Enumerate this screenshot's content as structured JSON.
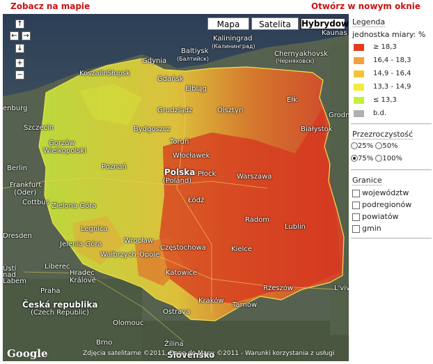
{
  "top": {
    "left_link": "Zobacz na mapie",
    "right_link": "Otwórz w nowym oknie"
  },
  "map": {
    "type_buttons": [
      "Mapa",
      "Satelita",
      "Hybrydowa"
    ],
    "selected_type": "Hybrydowa",
    "nav": {
      "up": "↑",
      "left": "←",
      "right": "→",
      "down": "↓",
      "zoom_in": "+",
      "zoom_out": "−"
    },
    "cities": {
      "kaliningrad": "Kaliningrad",
      "kaliningrad_ru": "(Калининград)",
      "kaunas": "Kaunas",
      "baltiysk": "Baltiysk",
      "baltiysk_ru": "(Балтийск)",
      "chernyakhovsk": "Chernyakhovsk",
      "chernyakhovsk_ru": "(Черняховск)",
      "gdynia": "Gdynia",
      "koszalin": "Koszalin",
      "slupsk": "Słupsk",
      "gdansk": "Gdańsk",
      "elblag": "Elbląg",
      "grudziadz": "Grudziądz",
      "olsztyn": "Olsztyn",
      "elk": "Ełk",
      "grodno": "Grodno",
      "szczecin": "Szczecin",
      "bydgoszcz": "Bydgoszcz",
      "torun": "Toruń",
      "bialystok": "Białystok",
      "gorzow": "Gorzów",
      "wielkopolski": "Wielkopolski",
      "wloclawek": "Włocławek",
      "berlin": "Berlin",
      "poznan": "Poznań",
      "polska": "Polska",
      "polska_sub": "(Poland)",
      "plock": "Płock",
      "warszawa": "Warszawa",
      "frankfurt": "Frankfurt",
      "frankfurt_sub": "(Oder)",
      "cottbus": "Cottbus",
      "lodz": "Łódź",
      "zielona_gora": "Zielona Góra",
      "radom": "Radom",
      "legnica": "Legnica",
      "lublin": "Lublin",
      "dresden": "Dresden",
      "jelenia_gora": "Jelenia Góra",
      "wroclaw": "Wrocław",
      "walbrzych": "Wałbrzych",
      "opole": "Opole",
      "czestochowa": "Częstochowa",
      "kielce": "Kielce",
      "usti": "Ústí",
      "usti_sub": "nad",
      "labem": "Labem",
      "liberec": "Liberec",
      "hradec": "Hradec",
      "kralove": "Králové",
      "katowice": "Katowice",
      "rzeszow": "Rzeszów",
      "lviv": "L'viv",
      "praha": "Praha",
      "ceska": "Česká republika",
      "czech": "(Czech Republic)",
      "ostrava": "Ostrava",
      "krakow": "Kraków",
      "tarnow": "Tarnów",
      "olomouc": "Olomouc",
      "brno": "Brno",
      "zilina": "Žilina",
      "slovensko": "Slovensko",
      "berlin_left": "enburg",
      "szczecin_left": "Szczecin"
    },
    "copyright": "Zdjęcia satelitarne ©2011, Dane do Mapy ©2011 - Warunki korzystania z usługi",
    "google_logo": "Google"
  },
  "panel": {
    "legend_title": "Legenda",
    "unit_label": "jednostka miary: %",
    "legend": [
      {
        "label": "≥ 18,3",
        "color": "#e03c1e"
      },
      {
        "label": "16,4 - 18,3",
        "color": "#f0a040"
      },
      {
        "label": "14,9 - 16,4",
        "color": "#f2c43a"
      },
      {
        "label": "13,3 - 14,9",
        "color": "#f4ec3a"
      },
      {
        "label": "≤ 13,3",
        "color": "#c4f03c"
      },
      {
        "label": "b.d.",
        "color": "#b0b0b0"
      }
    ],
    "transparency_title": "Przezroczystość",
    "transparency": [
      {
        "label": "25%",
        "selected": false
      },
      {
        "label": "50%",
        "selected": false
      },
      {
        "label": "75%",
        "selected": true
      },
      {
        "label": "100%",
        "selected": false
      }
    ],
    "boundaries_title": "Granice",
    "boundaries": [
      {
        "label": "województw",
        "checked": false
      },
      {
        "label": "podregionów",
        "checked": false
      },
      {
        "label": "powiatów",
        "checked": false
      },
      {
        "label": "gmin",
        "checked": false
      }
    ]
  }
}
